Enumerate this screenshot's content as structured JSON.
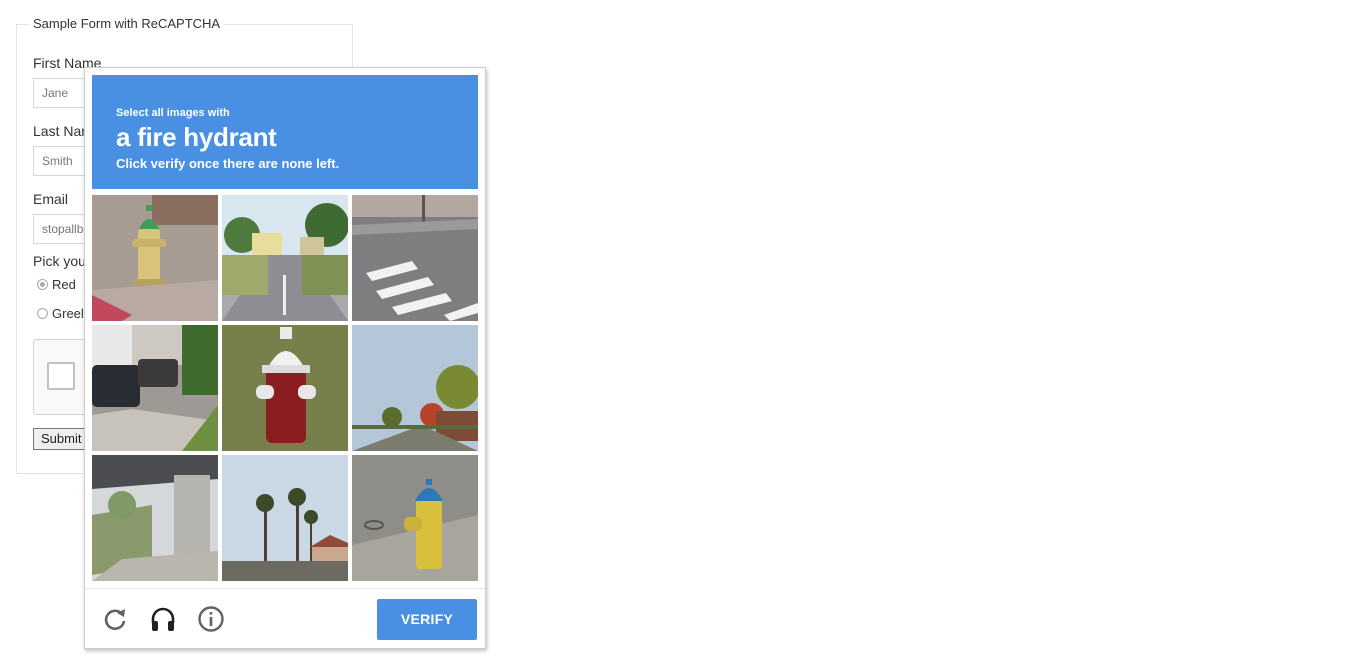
{
  "form": {
    "legend": "Sample Form with ReCAPTCHA",
    "first_name": {
      "label": "First Name",
      "value": "Jane"
    },
    "last_name": {
      "label": "Last Nar",
      "value": "Smith"
    },
    "email": {
      "label": "Email",
      "value": "stopallb"
    },
    "pick_label": "Pick you",
    "options": [
      {
        "label": "Red",
        "checked": true
      },
      {
        "label": "Greel",
        "checked": false
      }
    ],
    "submit_label": "Submit"
  },
  "challenge": {
    "instruction_small": "Select all images with",
    "instruction_big": "a fire hydrant",
    "instruction_sub": "Click verify once there are none left.",
    "header_color": "#4a90e2",
    "tiles": [
      "hydrant-green-top",
      "street-intersection",
      "crosswalk",
      "driveway-cars",
      "hydrant-red",
      "suburban-street",
      "overpass",
      "palm-trees",
      "hydrant-blue-top"
    ],
    "footer": {
      "icons": [
        "reload-icon",
        "audio-headphones-icon",
        "info-icon"
      ],
      "verify_label": "VERIFY"
    }
  }
}
